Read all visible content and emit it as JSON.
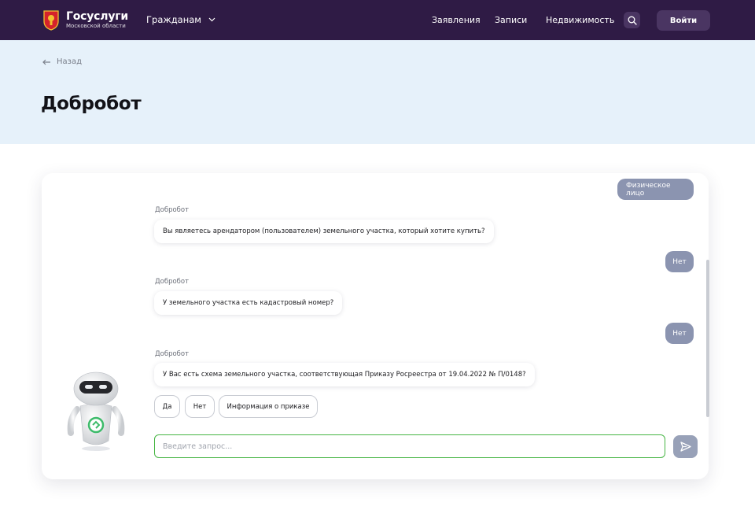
{
  "header": {
    "logo_title": "Госуслуги",
    "logo_subtitle": "Московской области",
    "citizens_label": "Гражданам",
    "nav": [
      "Заявления",
      "Записи",
      "Недвижимость"
    ],
    "login_label": "Войти",
    "colors": {
      "background": "#2f1b45",
      "button": "#4a3562"
    }
  },
  "hero": {
    "back_label": "Назад",
    "title": "Добробот"
  },
  "chat": {
    "messages": [
      {
        "from": "user",
        "text": "Физическое лицо"
      },
      {
        "from": "bot",
        "sender": "Добробот",
        "text": "Вы являетесь арендатором (пользователем) земельного участка, который хотите купить?"
      },
      {
        "from": "user",
        "text": "Нет"
      },
      {
        "from": "bot",
        "sender": "Добробот",
        "text": "У земельного участка есть кадастровый номер?"
      },
      {
        "from": "user",
        "text": "Нет"
      },
      {
        "from": "bot",
        "sender": "Добробот",
        "text": "У Вас есть схема земельного участка, соответствующая Приказу Росреестра от 19.04.2022 № П/0148?"
      }
    ],
    "quick_replies": [
      "Да",
      "Нет",
      "Информация о приказе"
    ],
    "input_placeholder": "Введите запрос...",
    "colors": {
      "user_bubble": "#8b94b0",
      "input_border": "#46b543",
      "robot_accent": "#3dbb6a"
    }
  }
}
